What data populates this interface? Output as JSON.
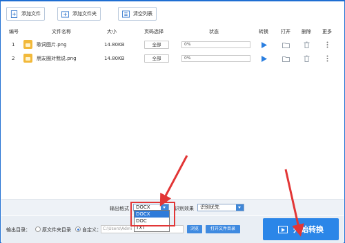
{
  "toolbar": {
    "add_file": "添加文件",
    "add_folder": "添加文件夹",
    "clear_list": "清空列表"
  },
  "table": {
    "headers": {
      "index": "编号",
      "name": "文件名称",
      "size": "大小",
      "pages": "页码选择",
      "status": "状态",
      "convert": "转换",
      "open": "打开",
      "delete": "删除",
      "more": "更多"
    },
    "rows": [
      {
        "index": "1",
        "name": "歌词图片.png",
        "size": "14.80KB",
        "pages": "全部",
        "progress": "0%",
        "progress_value": 0
      },
      {
        "index": "2",
        "name": "朋友圈对我说.png",
        "size": "14.80KB",
        "pages": "全部",
        "progress": "0%",
        "progress_value": 0
      }
    ]
  },
  "options": {
    "format_label": "输出格式",
    "format_value": "DOCX",
    "format_options": [
      "DOCX",
      "DOC",
      "TXT"
    ],
    "recog_label": "识别效果",
    "recog_value": "识别优先"
  },
  "output": {
    "dir_label": "输出目录：",
    "radio_source": "原文件夹目录",
    "radio_custom": "自定义：",
    "path": "C:\\Users\\Admi",
    "browse_label": "浏览",
    "open_folder_label": "打开文件目录",
    "start_label": "开始转换"
  },
  "colors": {
    "accent": "#2b86e8",
    "annotation": "#e23636",
    "selected_option": "#2f7bd9"
  }
}
